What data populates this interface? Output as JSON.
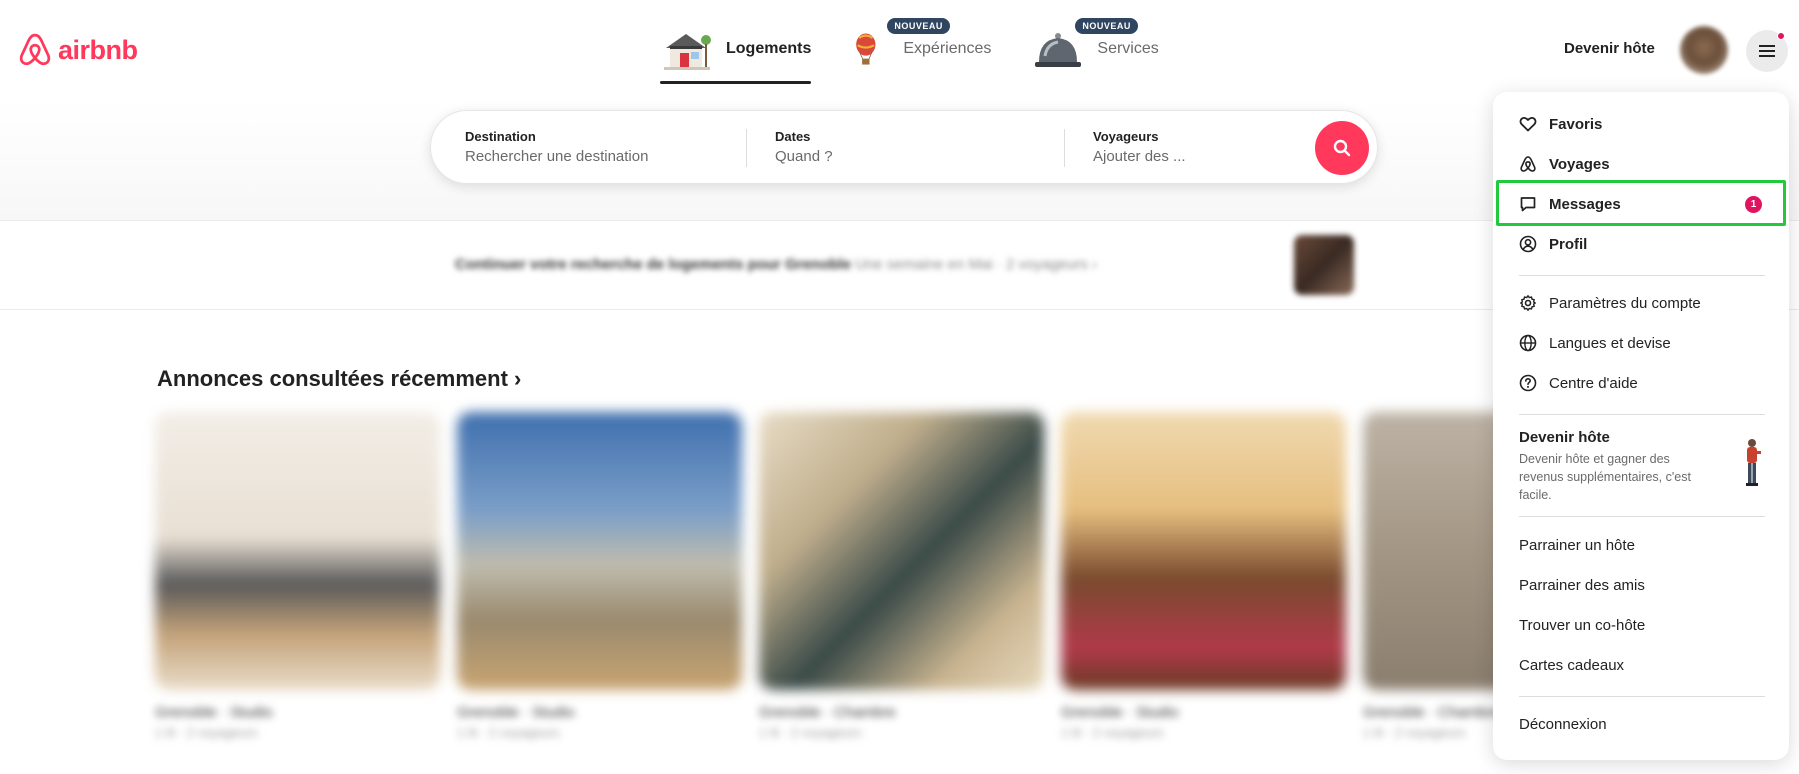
{
  "header": {
    "logo_text": "airbnb",
    "tabs": [
      {
        "label": "Logements",
        "active": true,
        "icon": "house-icon"
      },
      {
        "label": "Expériences",
        "badge": "NOUVEAU",
        "icon": "hot-air-balloon-icon"
      },
      {
        "label": "Services",
        "badge": "NOUVEAU",
        "icon": "service-bell-icon"
      }
    ],
    "host_link": "Devenir hôte"
  },
  "search": {
    "destination": {
      "label": "Destination",
      "placeholder": "Rechercher une destination"
    },
    "dates": {
      "label": "Dates",
      "placeholder": "Quand ?"
    },
    "travelers": {
      "label": "Voyageurs",
      "placeholder": "Ajouter des ..."
    }
  },
  "continue_banner": {
    "text": "Continuer votre recherche de logements pour Grenoble",
    "detail": "Une semaine en Mai · 2 voyageurs ›"
  },
  "recent": {
    "title": "Annonces consultées récemment",
    "chevron": "›",
    "cards": [
      {
        "title": "Grenoble · Studio",
        "sub": "1 lit · 2 voyageurs"
      },
      {
        "title": "Grenoble · Studio",
        "sub": "1 lit · 2 voyageurs"
      },
      {
        "title": "Grenoble · Chambre",
        "sub": "1 lit · 2 voyageurs"
      },
      {
        "title": "Grenoble · Studio",
        "sub": "1 lit · 2 voyageurs"
      },
      {
        "title": "Grenoble · Chambre",
        "sub": "1 lit · 2 voyageurs"
      }
    ]
  },
  "menu": {
    "items_top": [
      {
        "label": "Favoris",
        "icon": "heart-icon"
      },
      {
        "label": "Voyages",
        "icon": "airbnb-logo-icon"
      },
      {
        "label": "Messages",
        "icon": "message-icon",
        "badge": "1"
      },
      {
        "label": "Profil",
        "icon": "user-circle-icon"
      }
    ],
    "items_settings": [
      {
        "label": "Paramètres du compte",
        "icon": "gear-icon"
      },
      {
        "label": "Langues et devise",
        "icon": "globe-icon"
      },
      {
        "label": "Centre d'aide",
        "icon": "help-icon"
      }
    ],
    "host_promo": {
      "title": "Devenir hôte",
      "description": "Devenir hôte et gagner des revenus supplémentaires, c'est facile."
    },
    "items_links": [
      {
        "label": "Parrainer un hôte"
      },
      {
        "label": "Parrainer des amis"
      },
      {
        "label": "Trouver un co-hôte"
      },
      {
        "label": "Cartes cadeaux"
      }
    ],
    "logout": "Déconnexion"
  },
  "colors": {
    "brand": "#FF385C",
    "highlight": "#22C93D",
    "badge": "#E01561"
  }
}
